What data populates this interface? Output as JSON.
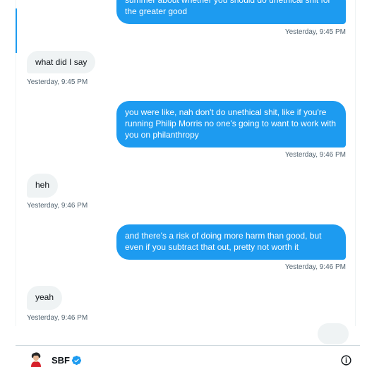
{
  "messages": [
    {
      "direction": "sent",
      "text": "summer about whether you should do unethical shit for the greater good",
      "timestamp": "Yesterday, 9:45 PM"
    },
    {
      "direction": "received",
      "text": "what did I say",
      "timestamp": "Yesterday, 9:45 PM"
    },
    {
      "direction": "sent",
      "text": "you were like, nah don't do unethical shit, like if you're running Philip Morris no one's going to want to work with you on philanthropy",
      "timestamp": "Yesterday, 9:46 PM"
    },
    {
      "direction": "received",
      "text": "heh",
      "timestamp": "Yesterday, 9:46 PM"
    },
    {
      "direction": "sent",
      "text": "and there's a risk of doing more harm than good, but even if you subtract that out, pretty not worth it",
      "timestamp": "Yesterday, 9:46 PM"
    },
    {
      "direction": "received",
      "text": "yeah",
      "timestamp": "Yesterday, 9:46 PM"
    }
  ],
  "footer": {
    "name": "SBF",
    "avatar_icon": "person-avatar-icon",
    "verified_icon": "verified-badge-icon",
    "info_icon": "info-icon"
  },
  "colors": {
    "accent": "#1d9bf0",
    "received_bubble": "#eff3f4",
    "secondary_text": "#536471"
  }
}
